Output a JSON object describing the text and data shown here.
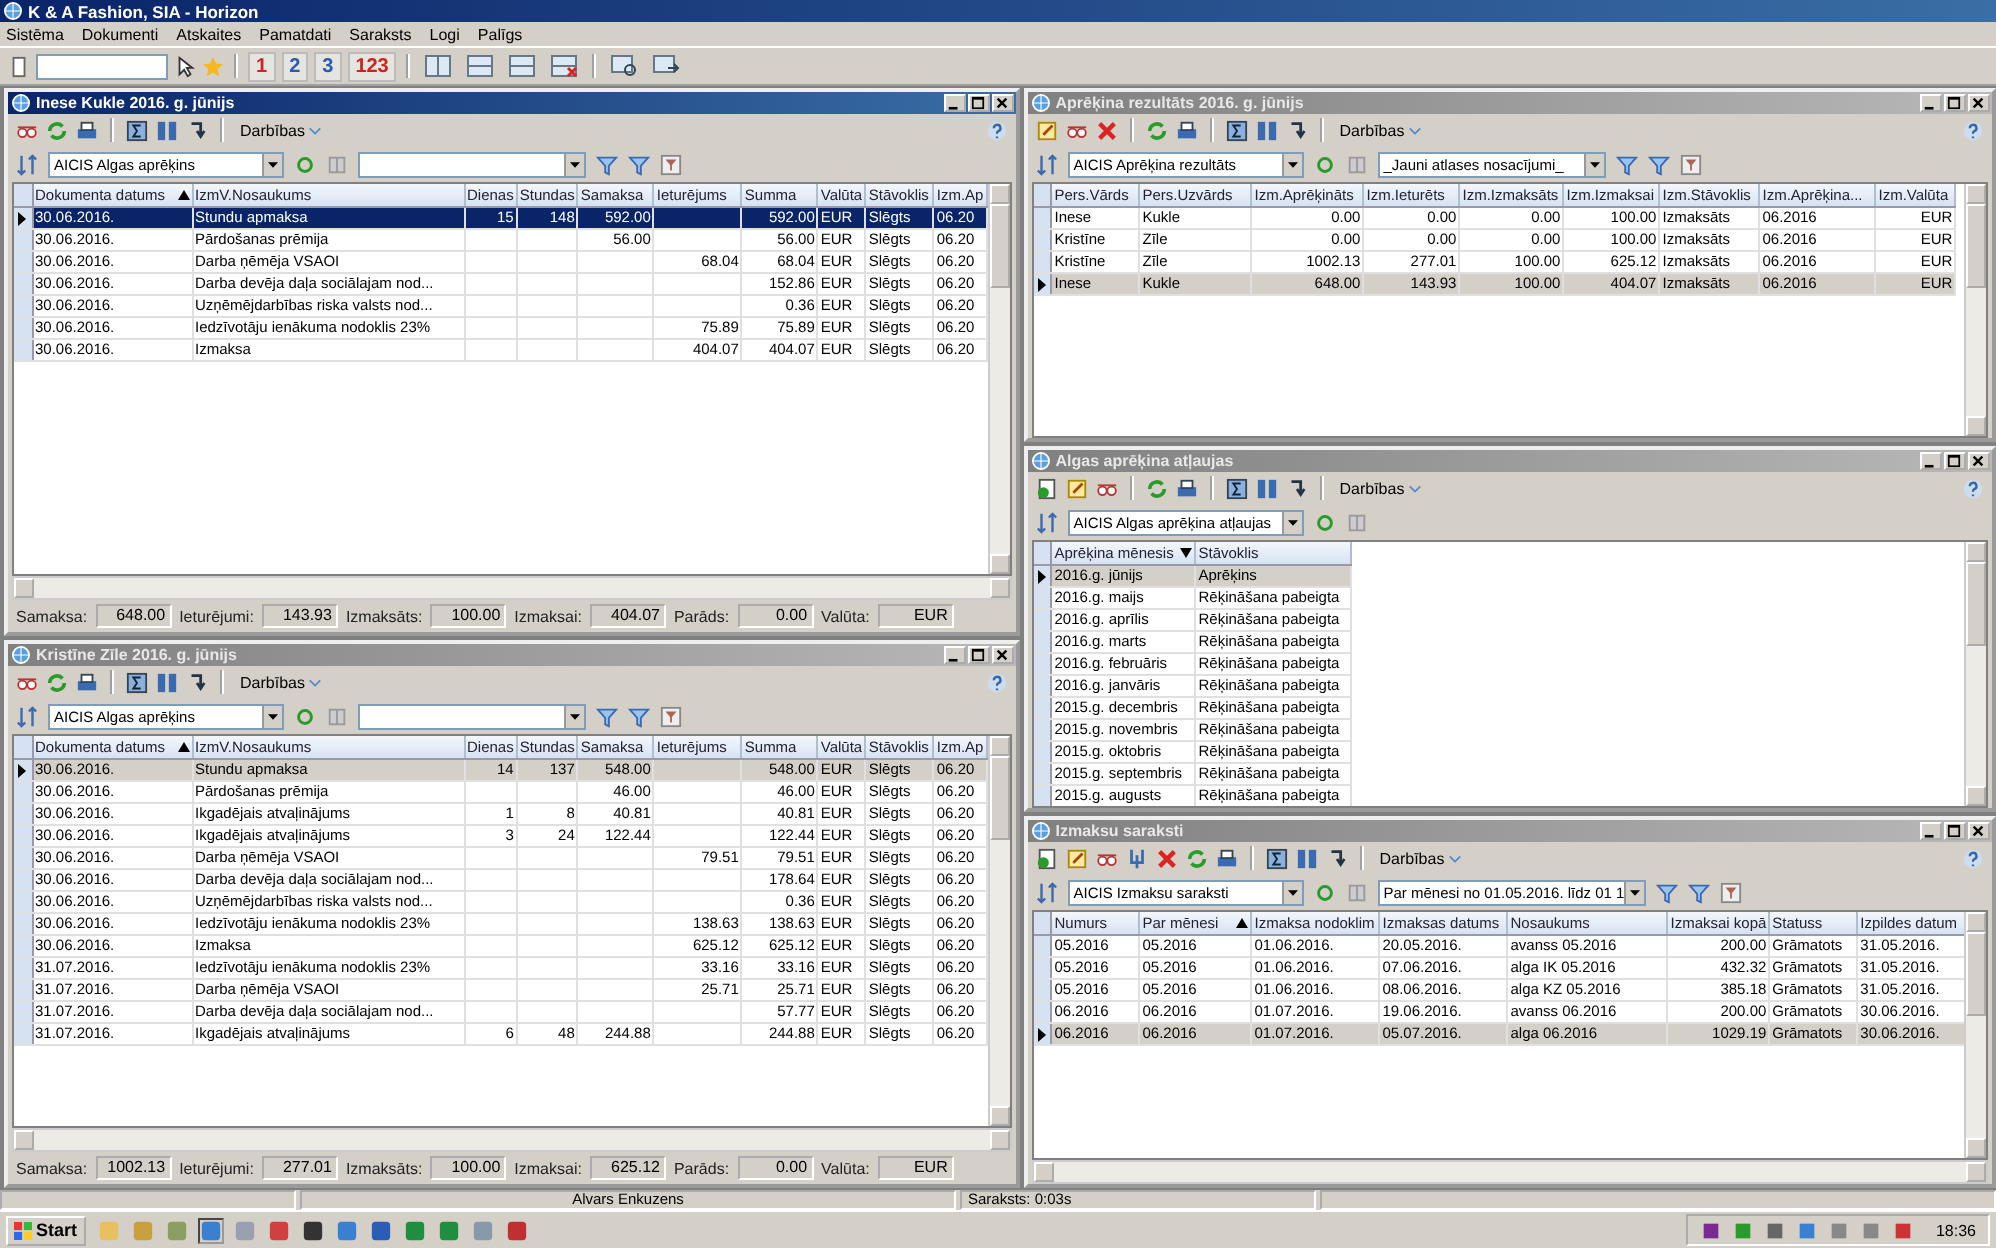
{
  "app_title": "K & A Fashion, SIA - Horizon",
  "menu": [
    "Sistēma",
    "Dokumenti",
    "Atskaites",
    "Pamatdati",
    "Saraksts",
    "Logi",
    "Palīgs"
  ],
  "toolbar_numbers": [
    "1",
    "2",
    "3",
    "123"
  ],
  "windows": [
    {
      "title": "Inese Kukle 2016. g. jūnijs",
      "active": true,
      "actions": "Darbības",
      "view": "AICIS Algas aprēķins",
      "filter_bar": true,
      "columns": [
        {
          "label": "Dokumenta datums",
          "sorted": true
        },
        {
          "label": "IzmV.Nosaukums",
          "sorted": false
        },
        {
          "label": "Dienas",
          "sorted": false
        },
        {
          "label": "Stundas",
          "sorted": false
        },
        {
          "label": "Samaksa",
          "sorted": false
        },
        {
          "label": "Ieturējums",
          "sorted": false
        },
        {
          "label": "Summa",
          "sorted": false
        },
        {
          "label": "Valūta",
          "sorted": false
        },
        {
          "label": "Stāvoklis",
          "sorted": false
        },
        {
          "label": "Izm.Ap",
          "sorted": false
        }
      ],
      "rows": [
        {
          "selected": true,
          "cells": [
            "30.06.2016.",
            "Stundu apmaksa",
            "15",
            "148",
            "592.00",
            null,
            "592.00",
            "EUR",
            "Slēgts",
            "06.20"
          ]
        },
        {
          "selected": false,
          "cells": [
            "30.06.2016.",
            "Pārdošanas prēmija",
            null,
            null,
            "56.00",
            null,
            "56.00",
            "EUR",
            "Slēgts",
            "06.20"
          ]
        },
        {
          "selected": false,
          "cells": [
            "30.06.2016.",
            "Darba ņēmēja VSAOI",
            null,
            null,
            null,
            "68.04",
            "68.04",
            "EUR",
            "Slēgts",
            "06.20"
          ]
        },
        {
          "selected": false,
          "cells": [
            "30.06.2016.",
            "Darba devēja daļa sociālajam nod...",
            null,
            null,
            null,
            null,
            "152.86",
            "EUR",
            "Slēgts",
            "06.20"
          ]
        },
        {
          "selected": false,
          "cells": [
            "30.06.2016.",
            "Uzņēmējdarbības riska valsts nod...",
            null,
            null,
            null,
            null,
            "0.36",
            "EUR",
            "Slēgts",
            "06.20"
          ]
        },
        {
          "selected": false,
          "cells": [
            "30.06.2016.",
            "Iedzīvotāju ienākuma nodoklis 23%",
            null,
            null,
            null,
            "75.89",
            "75.89",
            "EUR",
            "Slēgts",
            "06.20"
          ]
        },
        {
          "selected": false,
          "cells": [
            "30.06.2016.",
            "Izmaksa",
            null,
            null,
            null,
            "404.07",
            "404.07",
            "EUR",
            "Slēgts",
            "06.20"
          ]
        }
      ],
      "summary": [
        {
          "label": "Samaksa:",
          "value": "648.00"
        },
        {
          "label": "Ieturējumi:",
          "value": "143.93"
        },
        {
          "label": "Izmaksāts:",
          "value": "100.00"
        },
        {
          "label": "Izmaksai:",
          "value": "404.07"
        },
        {
          "label": "Parāds:",
          "value": "0.00"
        },
        {
          "label": "Valūta:",
          "value": "EUR"
        }
      ]
    },
    {
      "title": "Kristīne Zīle 2016. g. jūnijs",
      "active": false,
      "actions": "Darbības",
      "view": "AICIS Algas aprēķins",
      "filter_bar": true,
      "columns": [
        {
          "label": "Dokumenta datums",
          "sorted": true
        },
        {
          "label": "IzmV.Nosaukums",
          "sorted": false
        },
        {
          "label": "Dienas",
          "sorted": false
        },
        {
          "label": "Stundas",
          "sorted": false
        },
        {
          "label": "Samaksa",
          "sorted": false
        },
        {
          "label": "Ieturējums",
          "sorted": false
        },
        {
          "label": "Summa",
          "sorted": false
        },
        {
          "label": "Valūta",
          "sorted": false
        },
        {
          "label": "Stāvoklis",
          "sorted": false
        },
        {
          "label": "Izm.Ap",
          "sorted": false
        }
      ],
      "rows": [
        {
          "selected": true,
          "cells": [
            "30.06.2016.",
            "Stundu apmaksa",
            "14",
            "137",
            "548.00",
            null,
            "548.00",
            "EUR",
            "Slēgts",
            "06.20"
          ]
        },
        {
          "selected": false,
          "cells": [
            "30.06.2016.",
            "Pārdošanas prēmija",
            null,
            null,
            "46.00",
            null,
            "46.00",
            "EUR",
            "Slēgts",
            "06.20"
          ]
        },
        {
          "selected": false,
          "cells": [
            "30.06.2016.",
            "Ikgadējais atvaļinājums",
            "1",
            "8",
            "40.81",
            null,
            "40.81",
            "EUR",
            "Slēgts",
            "06.20"
          ]
        },
        {
          "selected": false,
          "cells": [
            "30.06.2016.",
            "Ikgadējais atvaļinājums",
            "3",
            "24",
            "122.44",
            null,
            "122.44",
            "EUR",
            "Slēgts",
            "06.20"
          ]
        },
        {
          "selected": false,
          "cells": [
            "30.06.2016.",
            "Darba ņēmēja VSAOI",
            null,
            null,
            null,
            "79.51",
            "79.51",
            "EUR",
            "Slēgts",
            "06.20"
          ]
        },
        {
          "selected": false,
          "cells": [
            "30.06.2016.",
            "Darba devēja daļa sociālajam nod...",
            null,
            null,
            null,
            null,
            "178.64",
            "EUR",
            "Slēgts",
            "06.20"
          ]
        },
        {
          "selected": false,
          "cells": [
            "30.06.2016.",
            "Uzņēmējdarbības riska valsts nod...",
            null,
            null,
            null,
            null,
            "0.36",
            "EUR",
            "Slēgts",
            "06.20"
          ]
        },
        {
          "selected": false,
          "cells": [
            "30.06.2016.",
            "Iedzīvotāju ienākuma nodoklis 23%",
            null,
            null,
            null,
            "138.63",
            "138.63",
            "EUR",
            "Slēgts",
            "06.20"
          ]
        },
        {
          "selected": false,
          "cells": [
            "30.06.2016.",
            "Izmaksa",
            null,
            null,
            null,
            "625.12",
            "625.12",
            "EUR",
            "Slēgts",
            "06.20"
          ]
        },
        {
          "selected": false,
          "cells": [
            "31.07.2016.",
            "Iedzīvotāju ienākuma nodoklis 23%",
            null,
            null,
            null,
            "33.16",
            "33.16",
            "EUR",
            "Slēgts",
            "06.20"
          ]
        },
        {
          "selected": false,
          "cells": [
            "31.07.2016.",
            "Darba ņēmēja VSAOI",
            null,
            null,
            null,
            "25.71",
            "25.71",
            "EUR",
            "Slēgts",
            "06.20"
          ]
        },
        {
          "selected": false,
          "cells": [
            "31.07.2016.",
            "Darba devēja daļa sociālajam nod...",
            null,
            null,
            null,
            null,
            "57.77",
            "EUR",
            "Slēgts",
            "06.20"
          ]
        },
        {
          "selected": false,
          "cells": [
            "31.07.2016.",
            "Ikgadējais atvaļinājums",
            "6",
            "48",
            "244.88",
            null,
            "244.88",
            "EUR",
            "Slēgts",
            "06.20"
          ]
        }
      ],
      "summary": [
        {
          "label": "Samaksa:",
          "value": "1002.13"
        },
        {
          "label": "Ieturējumi:",
          "value": "277.01"
        },
        {
          "label": "Izmaksāts:",
          "value": "100.00"
        },
        {
          "label": "Izmaksai:",
          "value": "625.12"
        },
        {
          "label": "Parāds:",
          "value": "0.00"
        },
        {
          "label": "Valūta:",
          "value": "EUR"
        }
      ]
    },
    {
      "title": "Aprēķina rezultāts 2016. g. jūnijs",
      "active": false,
      "actions": "Darbības",
      "view": "AICIS Aprēķina rezultāts",
      "filter_bar": true,
      "filter_value": "_Jauni atlases nosacījumi_",
      "columns": [
        {
          "label": "Pers.Vārds",
          "sorted": false
        },
        {
          "label": "Pers.Uzvārds",
          "sorted": false
        },
        {
          "label": "Izm.Aprēķināts",
          "sorted": false
        },
        {
          "label": "Izm.Ieturēts",
          "sorted": false
        },
        {
          "label": "Izm.Izmaksāts",
          "sorted": false
        },
        {
          "label": "Izm.Izmaksai",
          "sorted": false
        },
        {
          "label": "Izm.Stāvoklis",
          "sorted": false
        },
        {
          "label": "Izm.Aprēķina...",
          "sorted": false
        },
        {
          "label": "Izm.Valūta",
          "sorted": false
        }
      ],
      "rows": [
        {
          "selected": false,
          "cells": [
            "Inese",
            "Kukle",
            "0.00",
            "0.00",
            "0.00",
            "100.00",
            "Izmaksāts",
            "06.2016",
            "EUR"
          ]
        },
        {
          "selected": false,
          "cells": [
            "Kristīne",
            "Zīle",
            "0.00",
            "0.00",
            "0.00",
            "100.00",
            "Izmaksāts",
            "06.2016",
            "EUR"
          ]
        },
        {
          "selected": false,
          "cells": [
            "Kristīne",
            "Zīle",
            "1002.13",
            "277.01",
            "100.00",
            "625.12",
            "Izmaksāts",
            "06.2016",
            "EUR"
          ]
        },
        {
          "selected": true,
          "cells": [
            "Inese",
            "Kukle",
            "648.00",
            "143.93",
            "100.00",
            "404.07",
            "Izmaksāts",
            "06.2016",
            "EUR"
          ]
        }
      ]
    },
    {
      "title": "Algas aprēķina atļaujas",
      "active": false,
      "actions": "Darbības",
      "view": "AICIS Algas aprēķina atļaujas",
      "filter_bar": false,
      "columns": [
        {
          "label": "Aprēķina mēnesis",
          "sorted": true,
          "sort_descending": true
        },
        {
          "label": "Stāvoklis",
          "sorted": false
        }
      ],
      "rows": [
        {
          "selected": true,
          "cells": [
            "2016.g. jūnijs",
            "Aprēķins"
          ]
        },
        {
          "selected": false,
          "cells": [
            "2016.g. maijs",
            "Rēķināšana pabeigta"
          ]
        },
        {
          "selected": false,
          "cells": [
            "2016.g. aprīlis",
            "Rēķināšana pabeigta"
          ]
        },
        {
          "selected": false,
          "cells": [
            "2016.g. marts",
            "Rēķināšana pabeigta"
          ]
        },
        {
          "selected": false,
          "cells": [
            "2016.g. februāris",
            "Rēķināšana pabeigta"
          ]
        },
        {
          "selected": false,
          "cells": [
            "2016.g. janvāris",
            "Rēķināšana pabeigta"
          ]
        },
        {
          "selected": false,
          "cells": [
            "2015.g. decembris",
            "Rēķināšana pabeigta"
          ]
        },
        {
          "selected": false,
          "cells": [
            "2015.g. novembris",
            "Rēķināšana pabeigta"
          ]
        },
        {
          "selected": false,
          "cells": [
            "2015.g. oktobris",
            "Rēķināšana pabeigta"
          ]
        },
        {
          "selected": false,
          "cells": [
            "2015.g. septembris",
            "Rēķināšana pabeigta"
          ]
        },
        {
          "selected": false,
          "cells": [
            "2015.g. augusts",
            "Rēķināšana pabeigta"
          ]
        }
      ]
    },
    {
      "title": "Izmaksu saraksti",
      "active": false,
      "actions": "Darbības",
      "view": "AICIS Izmaksu saraksti",
      "filter_bar": true,
      "filter_value": "Par mēnesi no 01.05.2016. līdz 01 1",
      "columns": [
        {
          "label": "Numurs",
          "sorted": false
        },
        {
          "label": "Par mēnesi",
          "sorted": true
        },
        {
          "label": "Izmaksa nodoklim",
          "sorted": false
        },
        {
          "label": "Izmaksas datums",
          "sorted": false
        },
        {
          "label": "Nosaukums",
          "sorted": false
        },
        {
          "label": "Izmaksai kopā",
          "sorted": false
        },
        {
          "label": "Statuss",
          "sorted": false
        },
        {
          "label": "Izpildes datum",
          "sorted": false
        }
      ],
      "rows": [
        {
          "selected": false,
          "cells": [
            "05.2016",
            "05.2016",
            "01.06.2016.",
            "20.05.2016.",
            "avanss 05.2016",
            "200.00",
            "Grāmatots",
            "31.05.2016."
          ]
        },
        {
          "selected": false,
          "cells": [
            "05.2016",
            "05.2016",
            "01.06.2016.",
            "07.06.2016.",
            "alga IK 05.2016",
            "432.32",
            "Grāmatots",
            "31.05.2016."
          ]
        },
        {
          "selected": false,
          "cells": [
            "05.2016",
            "05.2016",
            "01.06.2016.",
            "08.06.2016.",
            "alga KZ 05.2016",
            "385.18",
            "Grāmatots",
            "31.05.2016."
          ]
        },
        {
          "selected": false,
          "cells": [
            "06.2016",
            "06.2016",
            "01.07.2016.",
            "19.06.2016.",
            "avanss 06.2016",
            "200.00",
            "Grāmatots",
            "30.06.2016."
          ]
        },
        {
          "selected": true,
          "cells": [
            "06.2016",
            "06.2016",
            "01.07.2016.",
            "05.07.2016.",
            "alga 06.2016",
            "1029.19",
            "Grāmatots",
            "30.06.2016."
          ]
        }
      ]
    }
  ],
  "status_bar": [
    "Alvars Enkuzens",
    "Saraksts: 0:03s"
  ],
  "taskbar": {
    "start": "Start",
    "clock": "18:36"
  }
}
